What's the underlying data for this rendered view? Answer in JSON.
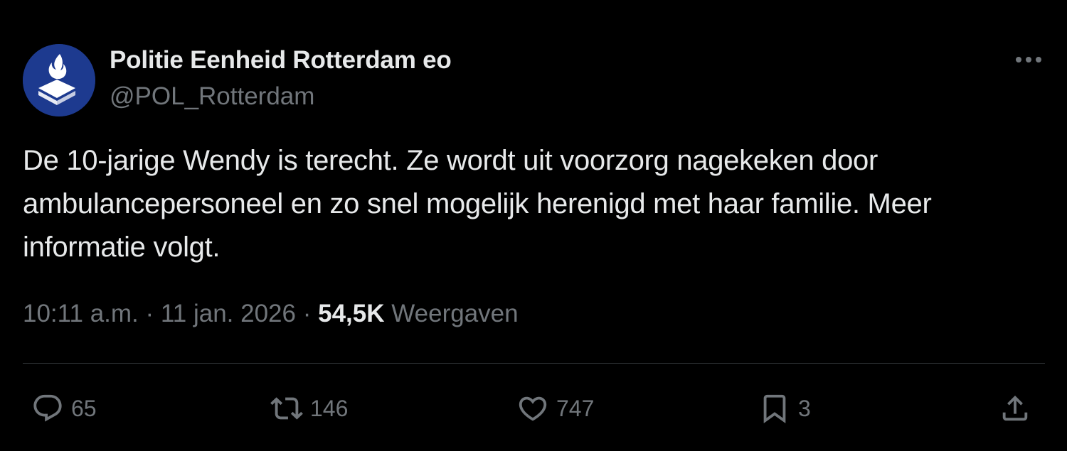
{
  "post": {
    "author": {
      "name": "Politie Eenheid Rotterdam eo",
      "handle": "@POL_Rotterdam",
      "avatar_color": "#1d3a8f",
      "avatar_icon": "police-logo-icon"
    },
    "more_icon": "more-options-icon",
    "text": "De 10-jarige Wendy is terecht. Ze wordt uit voorzorg nagekeken door ambulancepersoneel en zo snel mogelijk herenigd met haar familie. Meer informatie volgt.",
    "time": "10:11 a.m.",
    "separator": "·",
    "date": "11 jan. 2026",
    "views_count": "54,5K",
    "views_label": "Weergaven"
  },
  "actions": {
    "reply": {
      "icon": "reply-icon",
      "count": "65"
    },
    "retweet": {
      "icon": "retweet-icon",
      "count": "146"
    },
    "like": {
      "icon": "heart-icon",
      "count": "747"
    },
    "bookmark": {
      "icon": "bookmark-icon",
      "count": "3"
    },
    "share": {
      "icon": "share-icon"
    }
  },
  "colors": {
    "background": "#000000",
    "primary_text": "#e7e9ea",
    "secondary_text": "#71767b",
    "divider": "#2f3336"
  }
}
